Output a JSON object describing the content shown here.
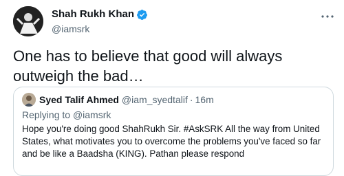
{
  "tweet": {
    "display_name": "Shah Rukh Khan",
    "handle": "@iamsrk",
    "text": "One has to believe that good will always outweigh the bad…",
    "verified": true,
    "more_icon": "more-horizontal-icon"
  },
  "quoted_tweet": {
    "display_name": "Syed Talif Ahmed",
    "handle": "@iam_syedtalif",
    "separator": "·",
    "time": "16m",
    "replying_prefix": "Replying to ",
    "replying_to": "@iamsrk",
    "text": "Hope you're doing good ShahRukh Sir. #AskSRK All the way from United States, what motivates you to overcome the problems you've faced so far and be like a Baadsha (KING). Pathan please respond"
  },
  "colors": {
    "verified_badge": "#1d9bf0",
    "secondary_text": "#536471",
    "border": "#cfd9de"
  }
}
